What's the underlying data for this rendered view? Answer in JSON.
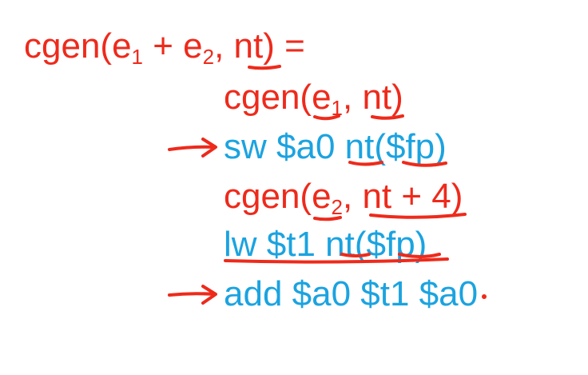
{
  "colors": {
    "red": "#ee2a1b",
    "blue": "#1ba3e0",
    "background": "#ffffff"
  },
  "lines": [
    {
      "pre": "cgen(e",
      "sub1": "1",
      "mid": " + e",
      "sub2": "2",
      "post": ", nt) ="
    },
    {
      "pre": "cgen(e",
      "sub1": "1",
      "post": ", nt)"
    },
    {
      "text": "sw $a0 nt($fp)"
    },
    {
      "pre": "cgen(e",
      "sub1": "2",
      "post": ", nt + 4)"
    },
    {
      "text": "lw $t1 nt($fp)"
    },
    {
      "text": "add $a0 $t1 $a0"
    }
  ]
}
